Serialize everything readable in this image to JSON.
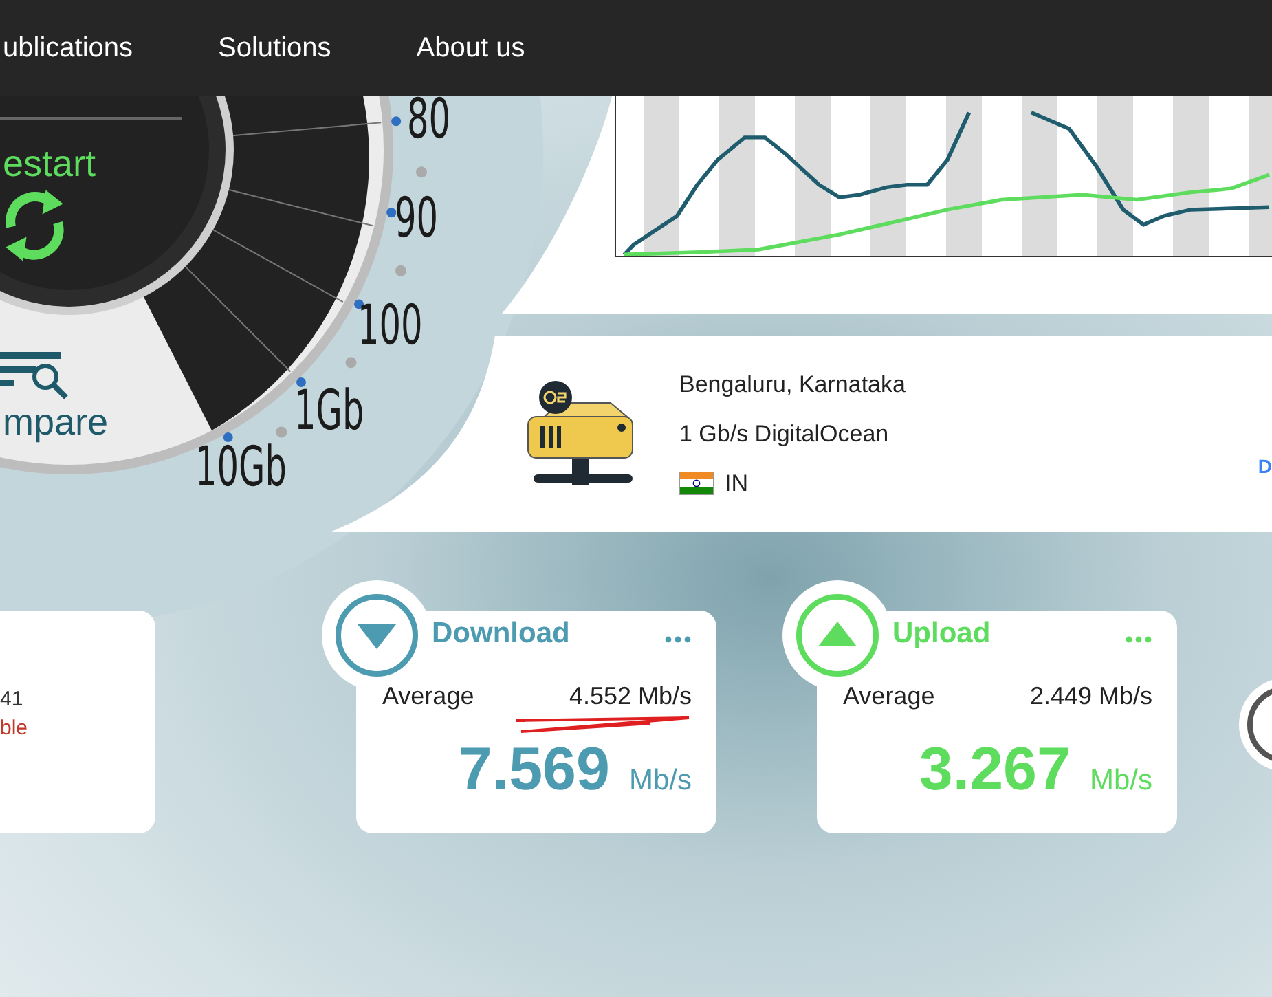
{
  "nav": {
    "items": [
      "ublications",
      "Solutions",
      "About us"
    ]
  },
  "gauge": {
    "restart_label": "estart",
    "compare_label": "mpare",
    "scale": [
      "80",
      "90",
      "100",
      "1Gb",
      "10Gb"
    ]
  },
  "server": {
    "location": "Bengaluru, Karnataka",
    "provider": "1 Gb/s DigitalOcean",
    "country": "IN",
    "link": "D"
  },
  "side_card": {
    "value": "41",
    "status": "ble"
  },
  "results": [
    {
      "kind": "download",
      "title": "Download",
      "average_label": "Average",
      "average": "4.552 Mb/s",
      "speed": "7.569",
      "unit": "Mb/s",
      "marked": true
    },
    {
      "kind": "upload",
      "title": "Upload",
      "average_label": "Average",
      "average": "2.449 Mb/s",
      "speed": "3.267",
      "unit": "Mb/s",
      "marked": false
    }
  ]
}
